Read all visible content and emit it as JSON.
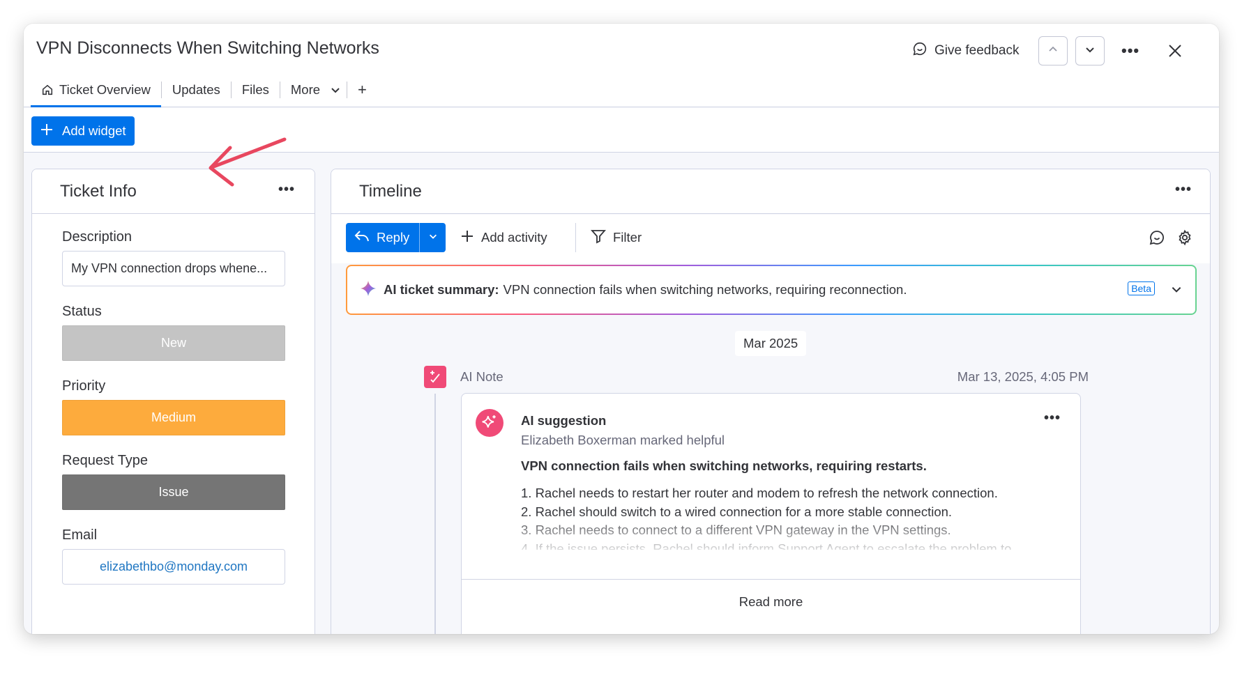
{
  "window": {
    "title": "VPN Disconnects When Switching Networks",
    "feedback_label": "Give feedback"
  },
  "tabs": [
    {
      "label": "Ticket Overview",
      "active": true,
      "icon": "home-icon"
    },
    {
      "label": "Updates"
    },
    {
      "label": "Files"
    },
    {
      "label": "More",
      "icon": "chevron-down-icon"
    },
    {
      "label": "+"
    }
  ],
  "toolbar": {
    "add_widget_label": "Add widget"
  },
  "ticket_info": {
    "title": "Ticket Info",
    "description_label": "Description",
    "description_value": "My VPN connection drops whene...",
    "status_label": "Status",
    "status_value": "New",
    "priority_label": "Priority",
    "priority_value": "Medium",
    "request_type_label": "Request Type",
    "request_type_value": "Issue",
    "email_label": "Email",
    "email_value": "elizabethbo@monday.com"
  },
  "timeline": {
    "title": "Timeline",
    "reply_label": "Reply",
    "add_activity_label": "Add activity",
    "filter_label": "Filter",
    "summary_label": "AI ticket summary:",
    "summary_text": "VPN connection fails when switching networks, requiring reconnection.",
    "beta_label": "Beta",
    "month_label": "Mar 2025",
    "note_label": "AI Note",
    "note_date": "Mar 13, 2025, 4:05 PM",
    "suggestion": {
      "title": "AI suggestion",
      "subtitle": "Elizabeth Boxerman marked helpful",
      "headline": "VPN connection fails when switching networks, requiring restarts.",
      "steps": [
        "1. Rachel needs to restart her router and modem to refresh the network connection.",
        "2. Rachel should switch to a wired connection for a more stable connection.",
        "3. Rachel needs to connect to a different VPN gateway in the VPN settings.",
        "4. If the issue persists, Rachel should inform Support Agent to escalate the problem to..."
      ],
      "read_more_label": "Read more"
    }
  },
  "colors": {
    "accent": "#0073ea",
    "status_new": "#c4c4c4",
    "priority_medium": "#fdab3d",
    "request_issue": "#757575",
    "ai_pink": "#f04a77",
    "annotation_arrow": "#e8475f"
  }
}
